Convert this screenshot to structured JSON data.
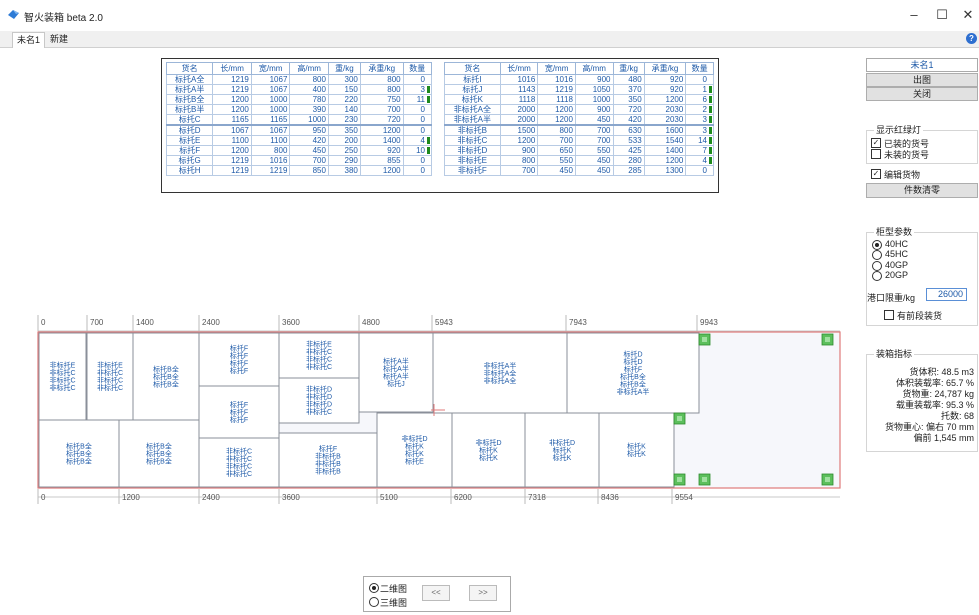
{
  "window": {
    "title": "智火装箱 beta 2.0",
    "controls": {
      "minimize": "–",
      "maximize": "☐",
      "close": "✕"
    }
  },
  "tabs": [
    {
      "label": "未名1"
    },
    {
      "label": "新建"
    }
  ],
  "help_label": "?",
  "cargo_table": {
    "headers": [
      "货名",
      "长/mm",
      "宽/mm",
      "高/mm",
      "重/kg",
      "承重/kg",
      "数量"
    ],
    "left_rows": [
      {
        "name": "标托A全",
        "l": "1219",
        "w": "1067",
        "h": "800",
        "wt": "300",
        "bear": "800",
        "qty": "0",
        "bar": false
      },
      {
        "name": "标托A半",
        "l": "1219",
        "w": "1067",
        "h": "400",
        "wt": "150",
        "bear": "800",
        "qty": "3",
        "bar": true
      },
      {
        "name": "标托B全",
        "l": "1200",
        "w": "1000",
        "h": "780",
        "wt": "220",
        "bear": "750",
        "qty": "11",
        "bar": true
      },
      {
        "name": "标托B半",
        "l": "1200",
        "w": "1000",
        "h": "390",
        "wt": "140",
        "bear": "700",
        "qty": "0",
        "bar": false
      },
      {
        "name": "标托C",
        "l": "1165",
        "w": "1165",
        "h": "1000",
        "wt": "230",
        "bear": "720",
        "qty": "0",
        "bar": false
      },
      {
        "name": "标托D",
        "l": "1067",
        "w": "1067",
        "h": "950",
        "wt": "350",
        "bear": "1200",
        "qty": "0",
        "bar": false
      },
      {
        "name": "标托E",
        "l": "1100",
        "w": "1100",
        "h": "420",
        "wt": "200",
        "bear": "1400",
        "qty": "4",
        "bar": true
      },
      {
        "name": "标托F",
        "l": "1200",
        "w": "800",
        "h": "450",
        "wt": "250",
        "bear": "920",
        "qty": "10",
        "bar": true
      },
      {
        "name": "标托G",
        "l": "1219",
        "w": "1016",
        "h": "700",
        "wt": "290",
        "bear": "855",
        "qty": "0",
        "bar": false
      },
      {
        "name": "标托H",
        "l": "1219",
        "w": "1219",
        "h": "850",
        "wt": "380",
        "bear": "1200",
        "qty": "0",
        "bar": false
      }
    ],
    "right_rows": [
      {
        "name": "标托I",
        "l": "1016",
        "w": "1016",
        "h": "900",
        "wt": "480",
        "bear": "920",
        "qty": "0",
        "bar": false
      },
      {
        "name": "标托J",
        "l": "1143",
        "w": "1219",
        "h": "1050",
        "wt": "370",
        "bear": "920",
        "qty": "1",
        "bar": true
      },
      {
        "name": "标托K",
        "l": "1118",
        "w": "1118",
        "h": "1000",
        "wt": "350",
        "bear": "1200",
        "qty": "6",
        "bar": true
      },
      {
        "name": "非标托A全",
        "l": "2000",
        "w": "1200",
        "h": "900",
        "wt": "720",
        "bear": "2030",
        "qty": "2",
        "bar": true
      },
      {
        "name": "非标托A半",
        "l": "2000",
        "w": "1200",
        "h": "450",
        "wt": "420",
        "bear": "2030",
        "qty": "3",
        "bar": true
      },
      {
        "name": "非标托B",
        "l": "1500",
        "w": "800",
        "h": "700",
        "wt": "630",
        "bear": "1600",
        "qty": "3",
        "bar": true
      },
      {
        "name": "非标托C",
        "l": "1200",
        "w": "700",
        "h": "700",
        "wt": "533",
        "bear": "1540",
        "qty": "14",
        "bar": true
      },
      {
        "name": "非标托D",
        "l": "900",
        "w": "650",
        "h": "550",
        "wt": "425",
        "bear": "1400",
        "qty": "7",
        "bar": true
      },
      {
        "name": "非标托E",
        "l": "800",
        "w": "550",
        "h": "450",
        "wt": "280",
        "bear": "1200",
        "qty": "4",
        "bar": true
      },
      {
        "name": "非标托F",
        "l": "700",
        "w": "450",
        "h": "450",
        "wt": "285",
        "bear": "1300",
        "qty": "0",
        "bar": false
      }
    ]
  },
  "right_panel": {
    "name_value": "未名1",
    "buttons": {
      "export": "出图",
      "close": "关闭"
    },
    "show_lights": {
      "title": "显示红绿灯",
      "loaded": "已装的货号",
      "unloaded": "未装的货号",
      "loaded_checked": true,
      "unloaded_checked": false
    },
    "edit_cargo": {
      "label": "编辑货物",
      "checked": true
    },
    "equalize_button": "件数清零",
    "container_params": {
      "title": "柜型参数",
      "options": [
        "40HC",
        "45HC",
        "40GP",
        "20GP"
      ],
      "selected": "40HC",
      "port_limit_label": "港口限重/kg",
      "port_limit_value": "26000",
      "front_section_label": "有前段装货",
      "front_section_checked": false
    },
    "stats": {
      "title": "装箱指标",
      "lines": [
        {
          "label": "货体积:",
          "value": "48.5 m3"
        },
        {
          "label": "体积装载率:",
          "value": "65.7 %"
        },
        {
          "label": "货物重:",
          "value": "24,787 kg"
        },
        {
          "label": "载重装载率:",
          "value": "95.3 %"
        },
        {
          "label": "托数:",
          "value": "68"
        },
        {
          "label": "货物重心:",
          "value": "偏右 70 mm"
        },
        {
          "label": "",
          "value": "偏前 1,545 mm"
        }
      ]
    }
  },
  "layout_view": {
    "top_ruler": [
      "0",
      "700",
      "1400",
      "2400",
      "3600",
      "4800",
      "5943",
      "7943",
      "9943"
    ],
    "bottom_ruler": [
      "0",
      "1200",
      "2400",
      "3600",
      "5100",
      "6200",
      "7318",
      "8436",
      "9554"
    ],
    "blocks": [
      {
        "lines": [
          "非标托E",
          "非标托C",
          "非标托C",
          "非标托C"
        ]
      },
      {
        "lines": [
          "非标托E",
          "非标托C",
          "非标托C",
          "非标托C"
        ]
      },
      {
        "lines": [
          "标托B全",
          "标托B全",
          "标托B全"
        ]
      },
      {
        "lines": [
          "标托F",
          "标托F",
          "标托F",
          "标托F"
        ]
      },
      {
        "lines": [
          "非标托E",
          "非标托C",
          "非标托C",
          "非标托C"
        ]
      },
      {
        "lines": [
          "标托A半",
          "标托A半",
          "标托A半",
          "标托J"
        ]
      },
      {
        "lines": [
          "非标托A半",
          "非标托A全",
          "非标托A全"
        ]
      },
      {
        "lines": [
          "标托D",
          "标托D",
          "标托F",
          "标托B全",
          "标托B全",
          "非标托A半"
        ]
      },
      {
        "lines": [
          "标托F",
          "标托F",
          "标托F"
        ]
      },
      {
        "lines": [
          "非标托D",
          "非标托D",
          "非标托D",
          "非标托C"
        ]
      },
      {
        "lines": [
          "标托B全",
          "标托B全",
          "标托B全"
        ]
      },
      {
        "lines": [
          "标托B全",
          "标托B全",
          "标托B全"
        ]
      },
      {
        "lines": [
          "非标托C",
          "非标托C",
          "非标托C",
          "非标托C"
        ]
      },
      {
        "lines": [
          "标托F",
          "非标托B",
          "非标托B",
          "非标托B"
        ]
      },
      {
        "lines": [
          "非标托D",
          "标托K",
          "标托K",
          "标托E"
        ]
      },
      {
        "lines": [
          "非标托D",
          "标托K",
          "标托K"
        ]
      },
      {
        "lines": [
          "非标托D",
          "标托K",
          "标托K"
        ]
      },
      {
        "lines": [
          "标托K",
          "标托K"
        ]
      }
    ]
  },
  "view_mode": {
    "options": [
      "二维图",
      "三维图"
    ],
    "selected": "二维图",
    "prev": "<<",
    "next": ">>"
  },
  "colors": {
    "accent_blue": "#1e5aa8",
    "green_indicator": "#1e8a1e",
    "container_border": "#e07a7a",
    "corner_marker": "#5cbf5c"
  }
}
